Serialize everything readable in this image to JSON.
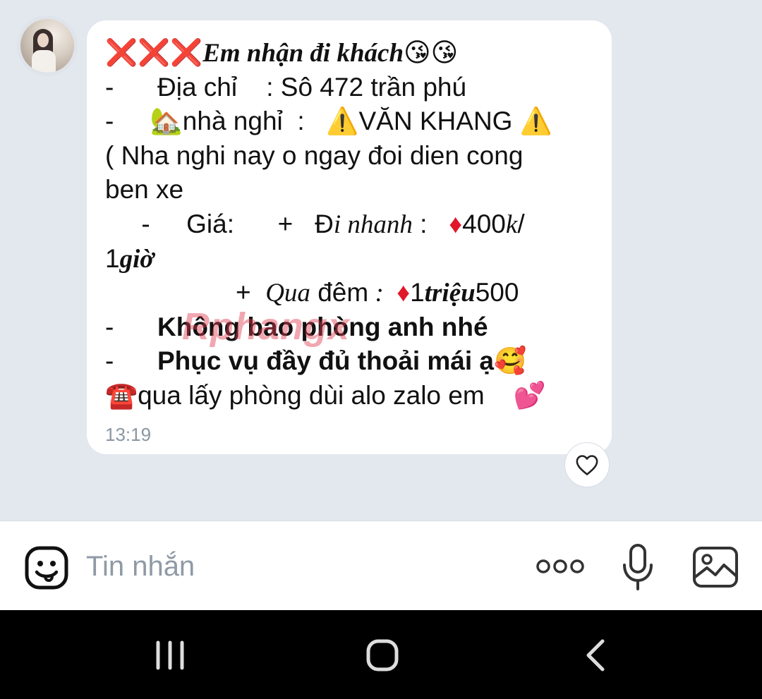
{
  "message": {
    "lines": [
      {
        "parts": [
          {
            "t": "❌❌❌",
            "c": "red"
          },
          {
            "t": "Em nhận đi khách",
            "c": "it b"
          },
          {
            "t": "😘😘",
            "c": ""
          }
        ]
      },
      {
        "parts": [
          {
            "t": "-      Địa chỉ    : Sô 472 trần phú",
            "c": ""
          }
        ]
      },
      {
        "parts": [
          {
            "t": "-     🏡nhà nghỉ  :   ⚠️VĂN KHANG ⚠️",
            "c": ""
          }
        ]
      },
      {
        "parts": [
          {
            "t": "( Nha nghi nay o ngay đoi dien cong",
            "c": ""
          }
        ]
      },
      {
        "parts": [
          {
            "t": "ben xe",
            "c": ""
          }
        ]
      },
      {
        "parts": [
          {
            "t": "     -     Giá:      +   Đ",
            "c": ""
          },
          {
            "t": "i nhanh",
            "c": "it"
          },
          {
            "t": " :   ",
            "c": ""
          },
          {
            "t": "♦",
            "c": "red"
          },
          {
            "t": "400",
            "c": ""
          },
          {
            "t": "k",
            "c": "it"
          },
          {
            "t": "/",
            "c": ""
          }
        ]
      },
      {
        "parts": [
          {
            "t": "1",
            "c": ""
          },
          {
            "t": "giờ",
            "c": "it b"
          }
        ]
      },
      {
        "parts": [
          {
            "t": "                  +  ",
            "c": ""
          },
          {
            "t": "Qua",
            "c": "it"
          },
          {
            "t": " đêm",
            "c": ""
          },
          {
            "t": " :  ",
            "c": "it"
          },
          {
            "t": "♦",
            "c": "red"
          },
          {
            "t": "1",
            "c": ""
          },
          {
            "t": "triệu",
            "c": "it b"
          },
          {
            "t": "500",
            "c": ""
          }
        ]
      },
      {
        "parts": [
          {
            "t": "-      ",
            "c": ""
          },
          {
            "t": "Không bao phòng anh nhé",
            "c": "b"
          }
        ]
      },
      {
        "parts": [
          {
            "t": "-      ",
            "c": ""
          },
          {
            "t": "Phục vụ đầy đủ thoải mái ạ",
            "c": "b"
          },
          {
            "t": "🥰",
            "c": ""
          }
        ]
      },
      {
        "parts": [
          {
            "t": "☎️qua lấy phòng dùi alo zalo em    💕",
            "c": ""
          }
        ]
      }
    ],
    "time": "13:19",
    "watermark": "Rphangx"
  },
  "composer": {
    "placeholder": "Tin nhắn"
  },
  "icons": {
    "sticker": "sticker-smile-icon",
    "more": "more-dots-icon",
    "mic": "microphone-icon",
    "image": "image-gallery-icon",
    "heart": "heart-reaction-icon",
    "nav_recent": "recent-apps-icon",
    "nav_home": "home-icon",
    "nav_back": "back-icon"
  },
  "colors": {
    "chat_bg": "#e3e8ef",
    "bubble_bg": "#ffffff",
    "accent_red": "#e0182a",
    "muted_text": "#8f9aa6"
  }
}
